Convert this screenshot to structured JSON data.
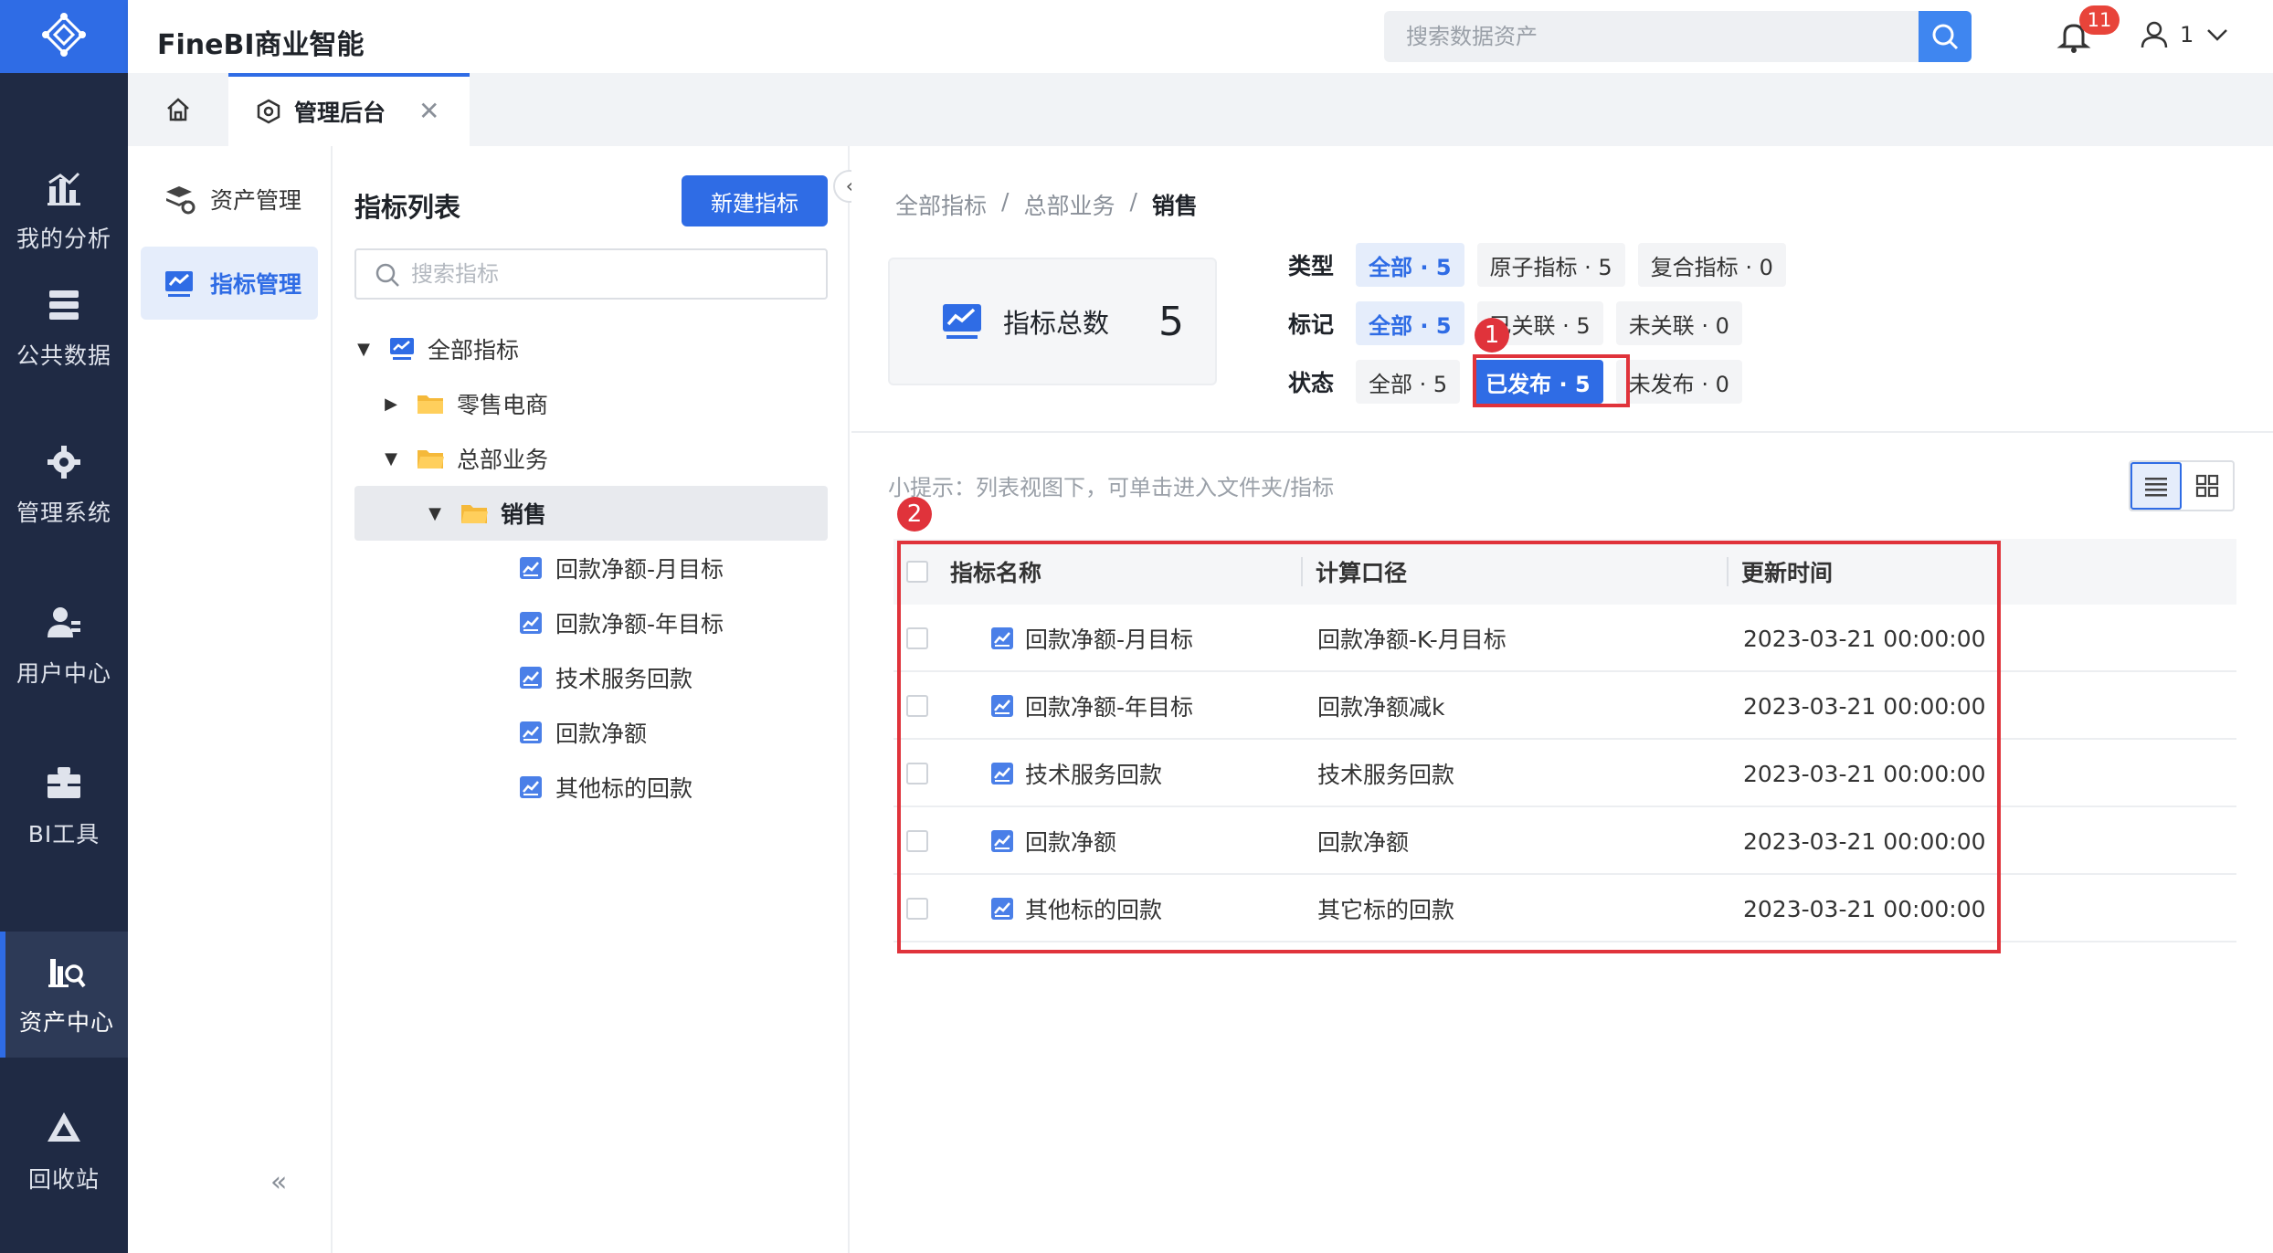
{
  "app": {
    "title": "FineBI商业智能"
  },
  "header": {
    "search_placeholder": "搜索数据资产",
    "notifications": "11",
    "user_name": "1"
  },
  "nav": {
    "items": [
      {
        "label": "我的分析",
        "icon": "bar-chart-icon"
      },
      {
        "label": "公共数据",
        "icon": "database-icon"
      },
      {
        "label": "管理系统",
        "icon": "gear-icon"
      },
      {
        "label": "用户中心",
        "icon": "user-group-icon"
      },
      {
        "label": "BI工具",
        "icon": "toolbox-icon"
      },
      {
        "label": "资产中心",
        "icon": "asset-search-icon"
      },
      {
        "label": "回收站",
        "icon": "recycle-icon"
      }
    ]
  },
  "tabs": {
    "active_label": "管理后台"
  },
  "subside": {
    "items": [
      {
        "label": "资产管理"
      },
      {
        "label": "指标管理"
      }
    ]
  },
  "tree": {
    "title": "指标列表",
    "new_button": "新建指标",
    "search_placeholder": "搜索指标",
    "nodes": [
      {
        "label": "全部指标"
      },
      {
        "label": "零售电商"
      },
      {
        "label": "总部业务"
      },
      {
        "label": "销售"
      },
      {
        "label": "回款净额-月目标"
      },
      {
        "label": "回款净额-年目标"
      },
      {
        "label": "技术服务回款"
      },
      {
        "label": "回款净额"
      },
      {
        "label": "其他标的回款"
      }
    ]
  },
  "breadcrumb": {
    "items": [
      "全部指标",
      "/",
      "总部业务",
      "/",
      "销售"
    ]
  },
  "summary": {
    "label": "指标总数",
    "value": "5"
  },
  "filters": {
    "type": {
      "label": "类型",
      "options": [
        "全部 · 5",
        "原子指标 · 5",
        "复合指标 · 0"
      ]
    },
    "mark": {
      "label": "标记",
      "options": [
        "全部 · 5",
        "已关联 · 5",
        "未关联 · 0"
      ]
    },
    "status": {
      "label": "状态",
      "options": [
        "全部 · 5",
        "已发布 · 5",
        "未发布 · 0"
      ]
    }
  },
  "markers": [
    "1",
    "2"
  ],
  "tip": "小提示：列表视图下，可单击进入文件夹/指标",
  "table": {
    "headers": [
      "指标名称",
      "计算口径",
      "更新时间"
    ],
    "rows": [
      {
        "name": "回款净额-月目标",
        "formula": "回款净额-K-月目标",
        "time": "2023-03-21 00:00:00"
      },
      {
        "name": "回款净额-年目标",
        "formula": "回款净额减k",
        "time": "2023-03-21 00:00:00"
      },
      {
        "name": "技术服务回款",
        "formula": "技术服务回款",
        "time": "2023-03-21 00:00:00"
      },
      {
        "name": "回款净额",
        "formula": "回款净额",
        "time": "2023-03-21 00:00:00"
      },
      {
        "name": "其他标的回款",
        "formula": "其它标的回款",
        "time": "2023-03-21 00:00:00"
      }
    ]
  },
  "colors": {
    "accent": "#2f6ce5",
    "nav_bg": "#1f2a44",
    "highlight": "#e0333b"
  }
}
